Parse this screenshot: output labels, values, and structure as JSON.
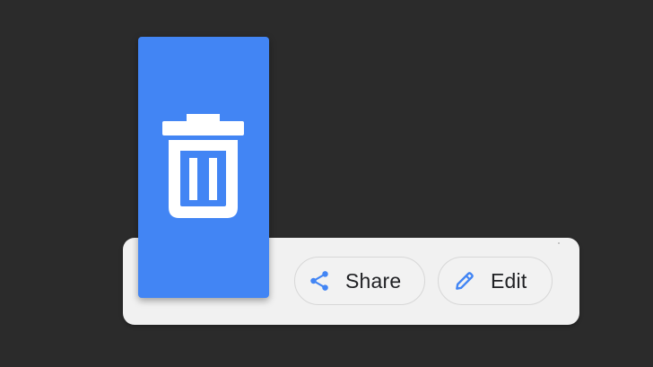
{
  "action_bar": {
    "delete": {
      "icon": "trash-icon"
    },
    "share": {
      "icon": "share-icon",
      "label": "Share"
    },
    "edit": {
      "icon": "pencil-icon",
      "label": "Edit"
    }
  },
  "colors": {
    "background": "#2b2b2b",
    "bar": "#f1f1f1",
    "accent": "#4285f4",
    "text": "#202124"
  }
}
